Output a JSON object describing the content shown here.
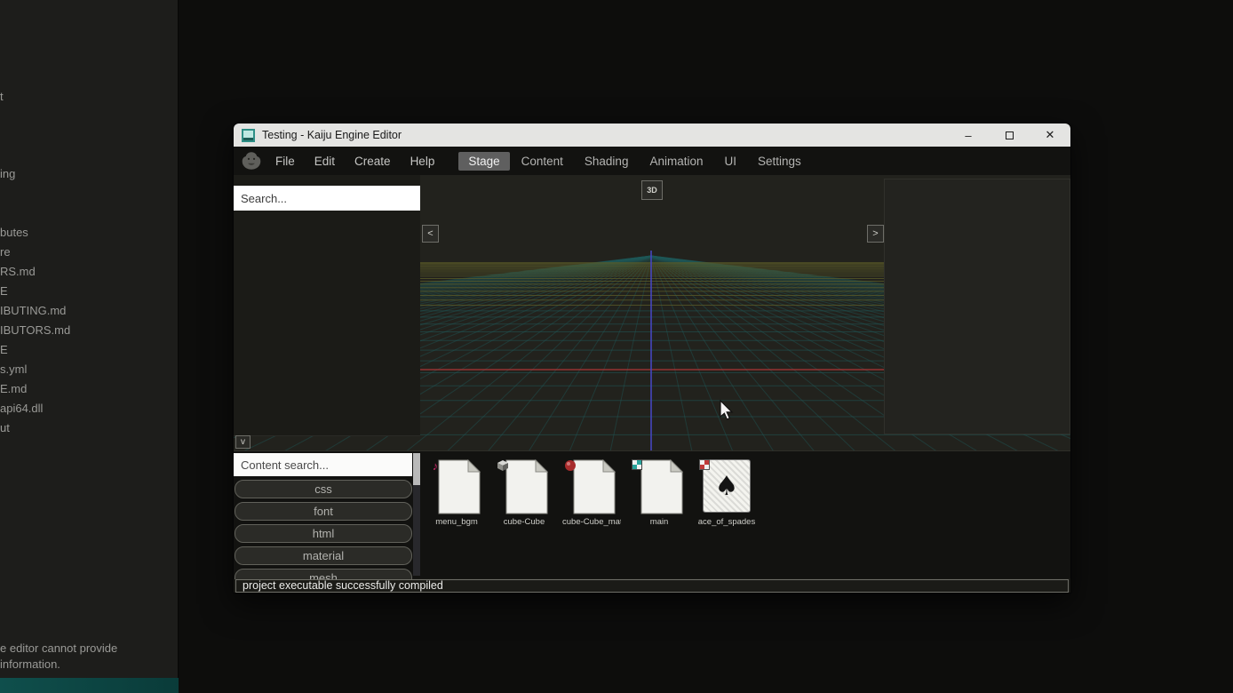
{
  "desktop": {
    "background_window": {
      "fragments": [
        "t",
        "ing",
        "butes",
        "re",
        "RS.md",
        "E",
        "IBUTING.md",
        "IBUTORS.md",
        "E",
        "s.yml",
        "E.md",
        "api64.dll",
        "ut"
      ],
      "notice_lines": [
        "e editor cannot provide",
        "information."
      ]
    }
  },
  "window": {
    "title": "Testing - Kaiju Engine Editor",
    "controls": {
      "minimize": "–",
      "close": "✕"
    },
    "menus": [
      "File",
      "Edit",
      "Create",
      "Help"
    ],
    "tabs": [
      {
        "label": "Stage",
        "active": true
      },
      {
        "label": "Content",
        "active": false
      },
      {
        "label": "Shading",
        "active": false
      },
      {
        "label": "Animation",
        "active": false
      },
      {
        "label": "UI",
        "active": false
      },
      {
        "label": "Settings",
        "active": false
      }
    ],
    "search_placeholder": "Search...",
    "viewport": {
      "mode_button": "3D",
      "prev_button": "<",
      "next_button": ">"
    },
    "content_browser": {
      "collapse_button": "v",
      "search_placeholder": "Content search...",
      "folders": [
        "css",
        "font",
        "html",
        "material",
        "mesh"
      ],
      "items": [
        {
          "name": "menu_bgm",
          "icon": "file",
          "badge": "music-note"
        },
        {
          "name": "cube-Cube",
          "icon": "file",
          "badge": "cube"
        },
        {
          "name": "cube-Cube_mat",
          "icon": "file",
          "badge": "material-sphere"
        },
        {
          "name": "main",
          "icon": "file",
          "badge": "checker-teal"
        },
        {
          "name": "ace_of_spades",
          "icon": "playing-card",
          "badge": "checker-red",
          "glyph": "♠"
        }
      ]
    },
    "status": "project executable successfully compiled",
    "colors": {
      "tab_active_bg": "#5f5f5f",
      "axis_x": "#a23535",
      "axis_z": "#4747c8",
      "grid_line": "#1f5858",
      "grid_far": "#5c5c28"
    }
  }
}
